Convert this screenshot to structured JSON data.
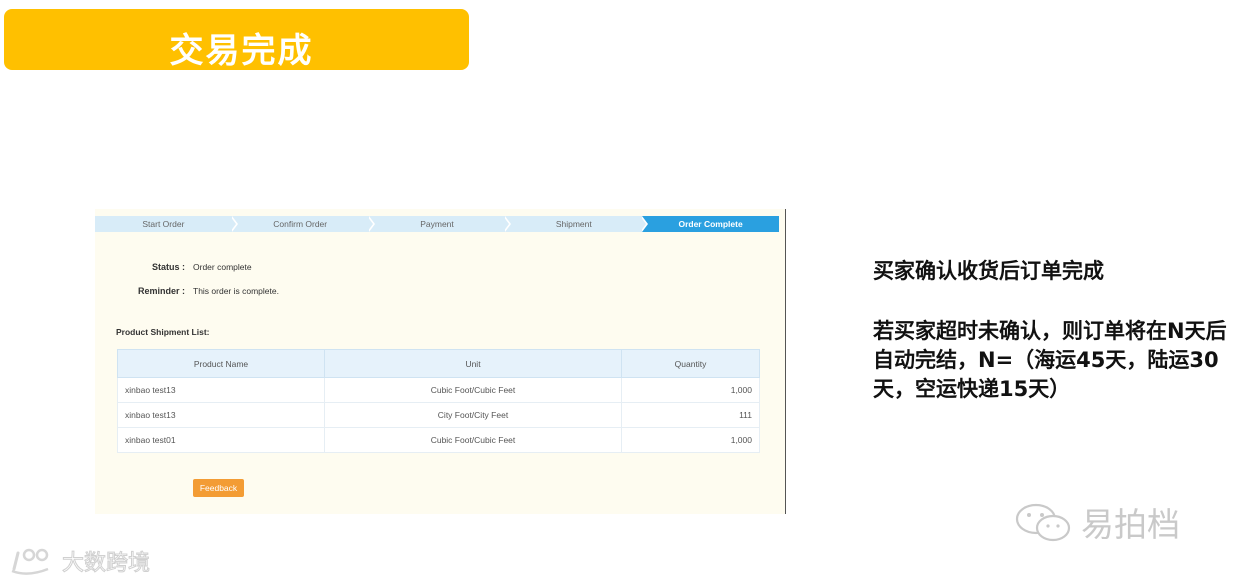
{
  "header": {
    "title": "交易完成"
  },
  "progress": {
    "steps": [
      "Start Order",
      "Confirm Order",
      "Payment",
      "Shipment",
      "Order Complete"
    ],
    "active_index": 4
  },
  "order": {
    "status_label": "Status :",
    "status_value": "Order complete",
    "reminder_label": "Reminder :",
    "reminder_value": "This order is complete."
  },
  "shipment": {
    "title": "Product Shipment List:",
    "columns": [
      "Product Name",
      "Unit",
      "Quantity"
    ],
    "rows": [
      [
        "xinbao test13",
        "Cubic Foot/Cubic Feet",
        "1,000"
      ],
      [
        "xinbao test13",
        "City Foot/City Feet",
        "111"
      ],
      [
        "xinbao test01",
        "Cubic Foot/Cubic Feet",
        "1,000"
      ]
    ]
  },
  "buttons": {
    "feedback": "Feedback"
  },
  "notes": {
    "line1": "买家确认收货后订单完成",
    "line2": "若买家超时未确认，则订单将在N天后自动完结，N=（海运45天，陆运30天，空运快递15天）"
  },
  "watermarks": {
    "right": "易拍档",
    "left": "大数跨境"
  },
  "colors": {
    "title_bar": "#ffc000",
    "active_step": "#2aa0e0",
    "feedback_button": "#f39c34"
  }
}
